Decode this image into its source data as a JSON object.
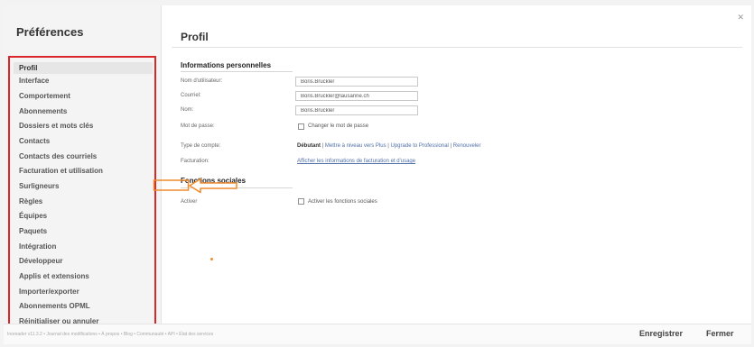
{
  "sidebar": {
    "title": "Préférences",
    "items": [
      {
        "label": "Profil"
      },
      {
        "label": "Interface"
      },
      {
        "label": "Comportement"
      },
      {
        "label": "Abonnements"
      },
      {
        "label": "Dossiers et mots clés"
      },
      {
        "label": "Contacts"
      },
      {
        "label": "Contacts des courriels"
      },
      {
        "label": "Facturation et utilisation"
      },
      {
        "label": "Surligneurs"
      },
      {
        "label": "Règles"
      },
      {
        "label": "Équipes"
      },
      {
        "label": "Paquets"
      },
      {
        "label": "Intégration"
      },
      {
        "label": "Développeur"
      },
      {
        "label": "Applis et extensions"
      },
      {
        "label": "Importer/exporter"
      },
      {
        "label": "Abonnements OPML"
      },
      {
        "label": "Réinitialiser ou annuler"
      }
    ]
  },
  "main": {
    "title": "Profil",
    "personal": {
      "section_title": "Informations personnelles",
      "username_label": "Nom d'utilisateur:",
      "username_value": "Boris.Bruckler",
      "email_label": "Courriel:",
      "email_value": "Boris.Bruckler@lausanne.ch",
      "name_label": "Nom:",
      "name_value": "Boris.Bruckler",
      "password_label": "Mot de passe:",
      "password_change": "Changer le mot de passe",
      "account_type_label": "Type de compte:",
      "account_type_value": "Débutant",
      "upgrade_plus": "Mettre à niveau vers Plus",
      "upgrade_pro": "Upgrade to Professional",
      "renew": "Renouveler",
      "sep": "|",
      "billing_label": "Facturation:",
      "billing_link": "Afficher les informations de facturation et d'usage"
    },
    "social": {
      "section_title": "Fonctions sociales",
      "label": "Activer",
      "checkbox_label": "Activer les fonctions sociales"
    }
  },
  "footer": {
    "info": "Inoreader v11.3.2 • Journal des modifications • À propos • Blog • Communauté • API • État des services",
    "save": "Enregistrer",
    "close": "Fermer"
  },
  "colors": {
    "highlight_red": "#d9262a",
    "arrow_orange": "#f08a2c"
  },
  "icons": {
    "close": "close-icon",
    "arrow": "left-arrow-annotation-icon"
  }
}
